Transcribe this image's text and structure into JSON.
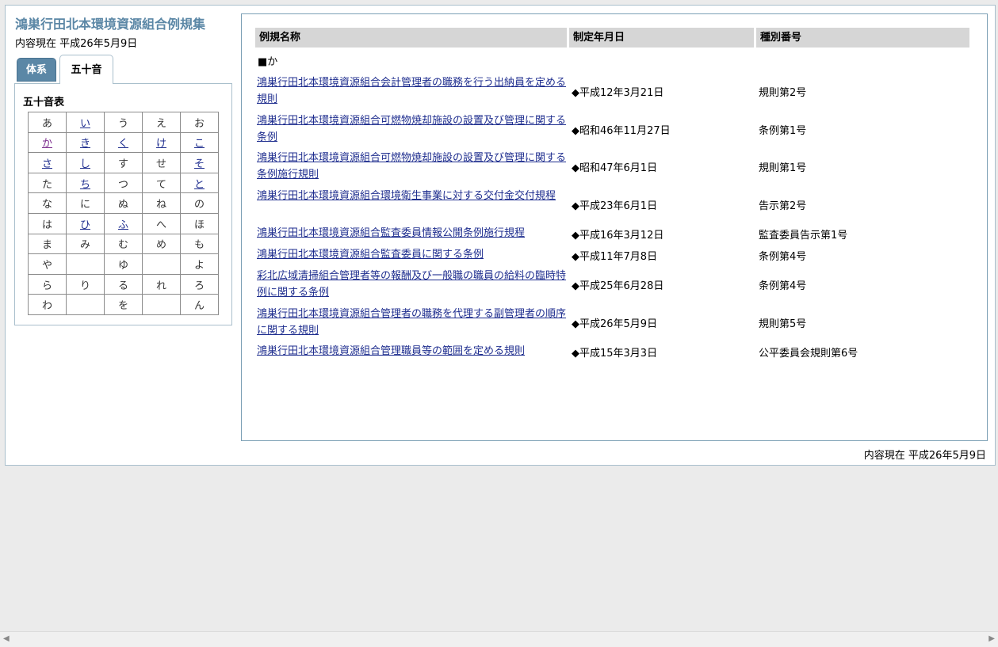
{
  "site": {
    "title": "鴻巣行田北本環境資源組合例規集",
    "current_date": "内容現在 平成26年5月9日"
  },
  "tabs": [
    {
      "label": "体系"
    },
    {
      "label": "五十音"
    }
  ],
  "kana_table": {
    "heading": "五十音表",
    "rows": [
      [
        {
          "t": "あ",
          "l": false
        },
        {
          "t": "い",
          "l": true
        },
        {
          "t": "う",
          "l": false
        },
        {
          "t": "え",
          "l": false
        },
        {
          "t": "お",
          "l": false
        }
      ],
      [
        {
          "t": "か",
          "l": true,
          "v": true
        },
        {
          "t": "き",
          "l": true
        },
        {
          "t": "く",
          "l": true
        },
        {
          "t": "け",
          "l": true
        },
        {
          "t": "こ",
          "l": true
        }
      ],
      [
        {
          "t": "さ",
          "l": true
        },
        {
          "t": "し",
          "l": true
        },
        {
          "t": "す",
          "l": false
        },
        {
          "t": "せ",
          "l": false
        },
        {
          "t": "そ",
          "l": true
        }
      ],
      [
        {
          "t": "た",
          "l": false
        },
        {
          "t": "ち",
          "l": true
        },
        {
          "t": "つ",
          "l": false
        },
        {
          "t": "て",
          "l": false
        },
        {
          "t": "と",
          "l": true
        }
      ],
      [
        {
          "t": "な",
          "l": false
        },
        {
          "t": "に",
          "l": false
        },
        {
          "t": "ぬ",
          "l": false
        },
        {
          "t": "ね",
          "l": false
        },
        {
          "t": "の",
          "l": false
        }
      ],
      [
        {
          "t": "は",
          "l": false
        },
        {
          "t": "ひ",
          "l": true
        },
        {
          "t": "ふ",
          "l": true
        },
        {
          "t": "へ",
          "l": false
        },
        {
          "t": "ほ",
          "l": false
        }
      ],
      [
        {
          "t": "ま",
          "l": false
        },
        {
          "t": "み",
          "l": false
        },
        {
          "t": "む",
          "l": false
        },
        {
          "t": "め",
          "l": false
        },
        {
          "t": "も",
          "l": false
        }
      ],
      [
        {
          "t": "や",
          "l": false
        },
        {
          "t": "",
          "l": false
        },
        {
          "t": "ゆ",
          "l": false
        },
        {
          "t": "",
          "l": false
        },
        {
          "t": "よ",
          "l": false
        }
      ],
      [
        {
          "t": "ら",
          "l": false
        },
        {
          "t": "り",
          "l": false
        },
        {
          "t": "る",
          "l": false
        },
        {
          "t": "れ",
          "l": false
        },
        {
          "t": "ろ",
          "l": false
        }
      ],
      [
        {
          "t": "わ",
          "l": false
        },
        {
          "t": "",
          "l": false
        },
        {
          "t": "を",
          "l": false
        },
        {
          "t": "",
          "l": false
        },
        {
          "t": "ん",
          "l": false
        }
      ]
    ]
  },
  "results": {
    "headers": {
      "name": "例規名称",
      "date": "制定年月日",
      "number": "種別番号"
    },
    "group_label": "■か",
    "rows": [
      {
        "title": "鴻巣行田北本環境資源組合会計管理者の職務を行う出納員を定める規則",
        "date": "◆平成12年3月21日",
        "number": "規則第2号"
      },
      {
        "title": "鴻巣行田北本環境資源組合可燃物焼却施設の設置及び管理に関する条例",
        "date": "◆昭和46年11月27日",
        "number": "条例第1号"
      },
      {
        "title": "鴻巣行田北本環境資源組合可燃物焼却施設の設置及び管理に関する条例施行規則",
        "date": "◆昭和47年6月1日",
        "number": "規則第1号"
      },
      {
        "title": "鴻巣行田北本環境資源組合環境衛生事業に対する交付金交付規程",
        "date": "◆平成23年6月1日",
        "number": "告示第2号"
      },
      {
        "title": "鴻巣行田北本環境資源組合監査委員情報公開条例施行規程",
        "date": "◆平成16年3月12日",
        "number": "監査委員告示第1号"
      },
      {
        "title": "鴻巣行田北本環境資源組合監査委員に関する条例",
        "date": "◆平成11年7月8日",
        "number": "条例第4号"
      },
      {
        "title": "彩北広域清掃組合管理者等の報酬及び一般職の職員の給料の臨時特例に関する条例",
        "date": "◆平成25年6月28日",
        "number": "条例第4号"
      },
      {
        "title": "鴻巣行田北本環境資源組合管理者の職務を代理する副管理者の順序に関する規則",
        "date": "◆平成26年5月9日",
        "number": "規則第5号"
      },
      {
        "title": "鴻巣行田北本環境資源組合管理職員等の範囲を定める規則",
        "date": "◆平成15年3月3日",
        "number": "公平委員会規則第6号"
      }
    ]
  },
  "footer": {
    "current_date": "内容現在 平成26年5月9日"
  },
  "colors": {
    "accent": "#5b87a6",
    "link": "#1f2e8f",
    "visited": "#7a2a8c",
    "header_bg": "#d6d6d6"
  }
}
